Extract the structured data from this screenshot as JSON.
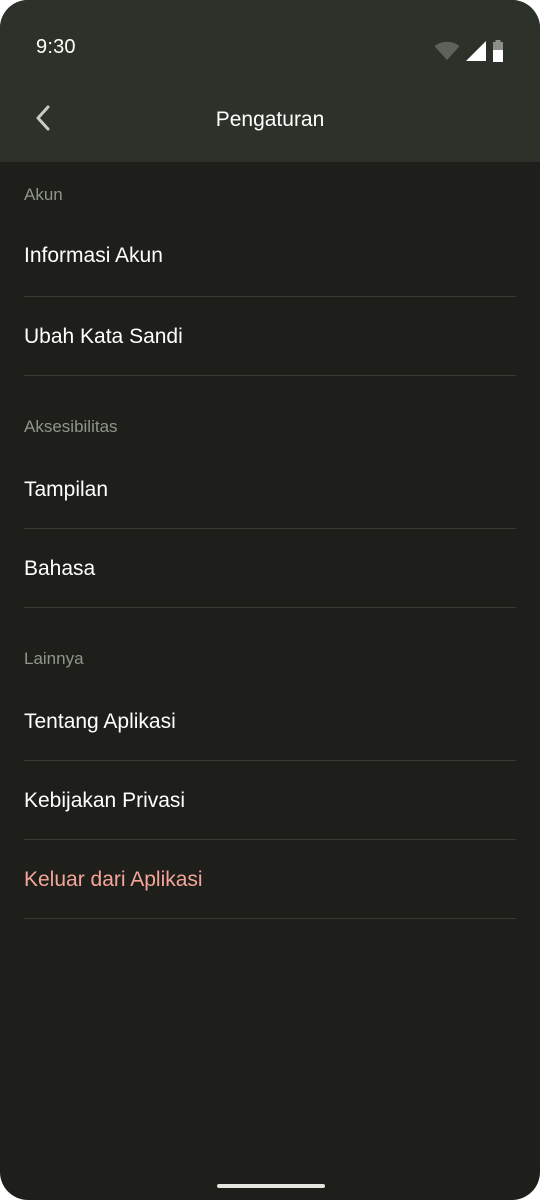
{
  "status_bar": {
    "time": "9:30",
    "icons": [
      "wifi-icon",
      "cell-signal-icon",
      "battery-icon"
    ]
  },
  "app_bar": {
    "back_icon": "chevron-left-icon",
    "title": "Pengaturan"
  },
  "sections": [
    {
      "header": "Akun",
      "items": [
        {
          "label": "Informasi Akun"
        },
        {
          "label": "Ubah Kata Sandi"
        }
      ]
    },
    {
      "header": "Aksesibilitas",
      "items": [
        {
          "label": "Tampilan"
        },
        {
          "label": "Bahasa"
        }
      ]
    },
    {
      "header": "Lainnya",
      "items": [
        {
          "label": "Tentang Aplikasi"
        },
        {
          "label": "Kebijakan Privasi"
        },
        {
          "label": "Keluar dari Aplikasi",
          "style": "danger"
        }
      ]
    }
  ],
  "colors": {
    "background": "#1e1e1a",
    "top_bar": "#2c3129",
    "section_header": "#8f958b",
    "divider": "#383a34",
    "danger": "#f4a59a"
  }
}
